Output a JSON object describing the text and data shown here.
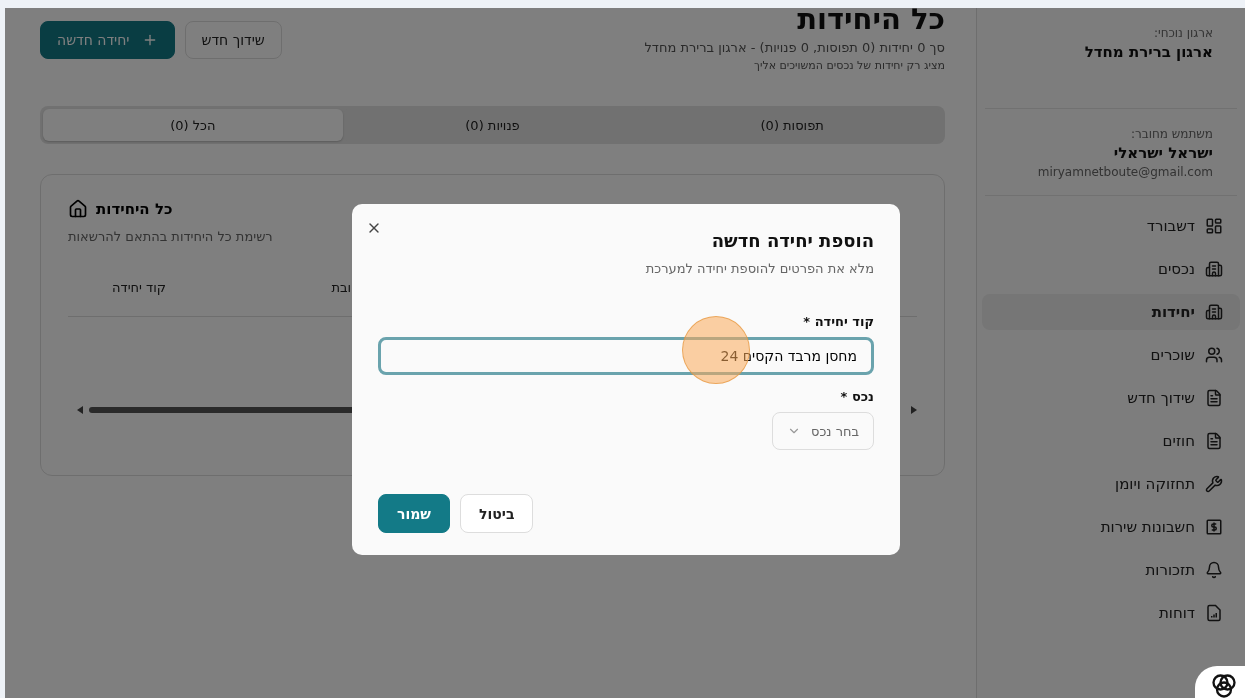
{
  "sidebar": {
    "org_label": "ארגון נוכחי:",
    "org_name": "ארגון ברירת מחדל",
    "user_label": "משתמש מחובר:",
    "user_name": "ישראל ישראלי",
    "user_email": "miryamnetboute@gmail.com",
    "items": [
      {
        "label": "דשבורד",
        "selected": false
      },
      {
        "label": "נכסים",
        "selected": false
      },
      {
        "label": "יחידות",
        "selected": true
      },
      {
        "label": "שוכרים",
        "selected": false
      },
      {
        "label": "שידוך חדש",
        "selected": false
      },
      {
        "label": "חוזים",
        "selected": false
      },
      {
        "label": "תחזוקה ויומן",
        "selected": false
      },
      {
        "label": "חשבונות שירות",
        "selected": false
      },
      {
        "label": "תזכורות",
        "selected": false
      },
      {
        "label": "דוחות",
        "selected": false
      }
    ]
  },
  "header": {
    "title": "כל היחידות",
    "summary": "סך 0 יחידות (0 תפוסות, 0 פנויות) - ארגון ברירת מחדל",
    "note": "מציג רק יחידות של נכסים המשויכים אליך",
    "buttons": [
      {
        "label": "שידוך חדש",
        "kind": "secondary"
      },
      {
        "label": "יחידה חדשה",
        "kind": "primary"
      }
    ]
  },
  "tabs": [
    {
      "label": "תפוסות (0)",
      "selected": false
    },
    {
      "label": "פנויות (0)",
      "selected": false
    },
    {
      "label": "הכל (0)",
      "selected": true
    }
  ],
  "card": {
    "title": "כל היחידות",
    "subtitle": "רשימת כל היחידות בהתאם להרשאות",
    "columns": [
      "ובת",
      "קוד יחידה"
    ]
  },
  "dialog": {
    "title": "הוספת יחידה חדשה",
    "description": "מלא את הפרטים להוספת יחידה למערכת",
    "fields": [
      {
        "kind": "text",
        "label": "קוד יחידה *",
        "value": "מחסן מרבד הקסים 24",
        "focused": true
      },
      {
        "kind": "select",
        "label": "נכס *",
        "placeholder": "בחר נכס"
      }
    ],
    "buttons": [
      {
        "label": "ביטול",
        "kind": "secondary"
      },
      {
        "label": "שמור",
        "kind": "primary"
      }
    ]
  }
}
